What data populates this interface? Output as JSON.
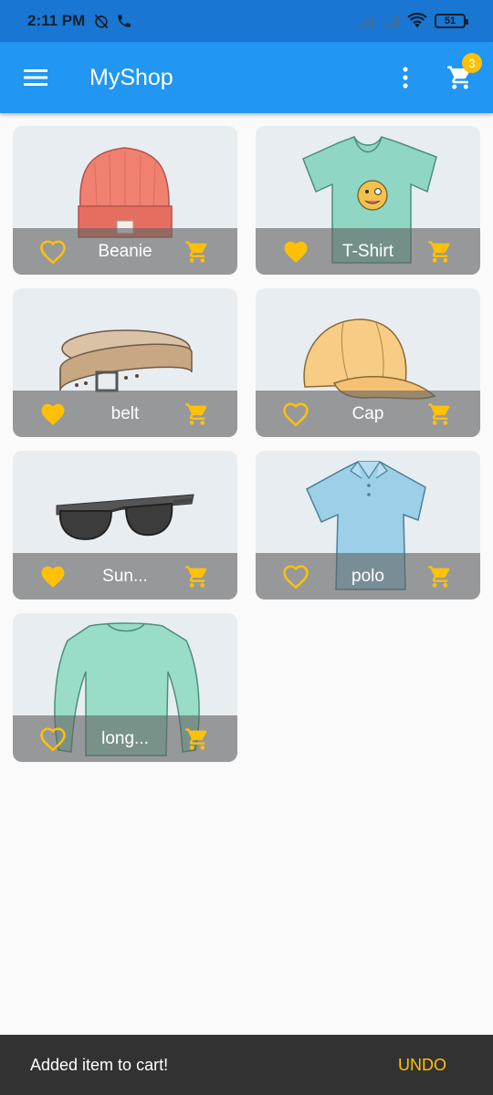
{
  "status_bar": {
    "time": "2:11 PM",
    "battery": "51",
    "icons": [
      "alarm-off-icon",
      "phone-icon",
      "signal-icon",
      "signal-icon",
      "wifi-icon",
      "battery-icon"
    ]
  },
  "app_bar": {
    "title": "MyShop",
    "cart_count": "3",
    "colors": {
      "primary": "#2196f3",
      "status": "#1976d2",
      "accent": "#ffc107"
    }
  },
  "products": [
    {
      "name": "Beanie",
      "favorite": false,
      "image": "beanie-illustration"
    },
    {
      "name": "T-Shirt",
      "favorite": true,
      "image": "tshirt-illustration"
    },
    {
      "name": "belt",
      "favorite": true,
      "image": "belt-illustration"
    },
    {
      "name": "Cap",
      "favorite": false,
      "image": "cap-illustration"
    },
    {
      "name": "Sun...",
      "favorite": true,
      "image": "sunglasses-illustration"
    },
    {
      "name": "polo",
      "favorite": false,
      "image": "polo-illustration"
    },
    {
      "name": "long...",
      "favorite": false,
      "image": "long-sleeve-illustration"
    }
  ],
  "snackbar": {
    "message": "Added item to cart!",
    "action": "UNDO"
  }
}
